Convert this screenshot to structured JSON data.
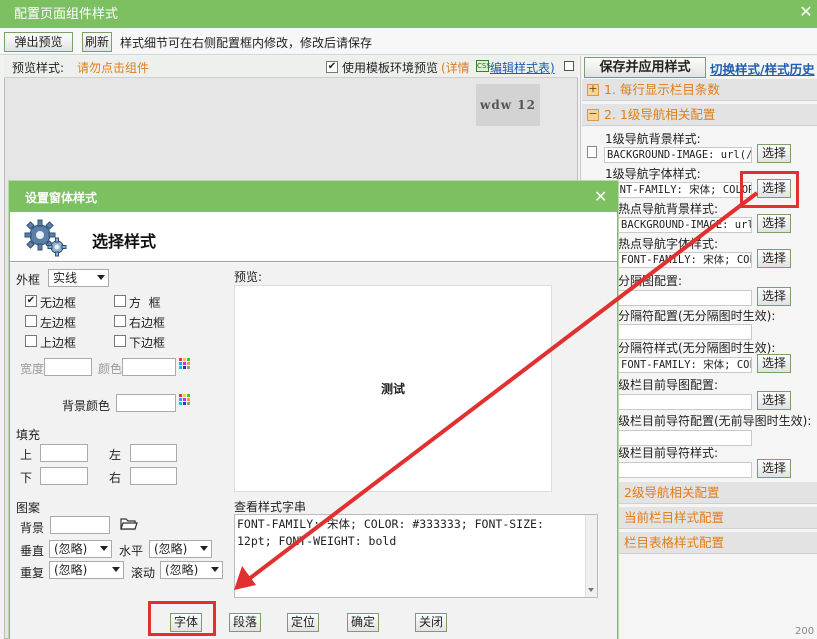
{
  "window": {
    "title": "配置页面组件样式",
    "close": "✕"
  },
  "toolbar": {
    "popup_preview": "弹出预览",
    "refresh": "刷新",
    "hint": "样式细节可在右侧配置框内修改，修改后请保存"
  },
  "preview": {
    "label": "预览样式:",
    "hint": "请勿点击组件",
    "template_checked": true,
    "template_label": "使用模板环境预览",
    "detail_link": "(详情",
    "edit_link": "编辑样式表)",
    "sample_text": "wdw 12"
  },
  "right": {
    "save_button": "保存并应用样式",
    "switch_link": "切换样式/样式历史",
    "sections": [
      {
        "label": "1. 每行显示栏目条数",
        "icon": "+"
      },
      {
        "label": "2. 1级导航相关配置",
        "icon": "−"
      },
      {
        "label": "2级导航相关配置",
        "icon": "+"
      },
      {
        "label": "当前栏目样式配置",
        "icon": "+"
      },
      {
        "label": "栏目表格样式配置",
        "icon": "+"
      }
    ],
    "config_items": [
      {
        "label": "1级导航背景样式:",
        "value": "BACKGROUND-IMAGE: url(/s",
        "button": "选择"
      },
      {
        "label": "1级导航字体样式:",
        "value": "FONT-FAMILY: 宋体; COLOR",
        "button": "选择"
      },
      {
        "label": "热点导航背景样式:",
        "value": "BACKGROUND-IMAGE: url(/s",
        "button": "选择"
      },
      {
        "label": "热点导航字体样式:",
        "value": "FONT-FAMILY: 宋体; COLOR",
        "button": "选择"
      },
      {
        "label": "分隔图配置:",
        "value": "",
        "button": "选择"
      },
      {
        "label": "分隔符配置(无分隔图时生效):",
        "value": "",
        "button": ""
      },
      {
        "label": "分隔符样式(无分隔图时生效):",
        "value": "FONT-FAMILY: 宋体; COLOR",
        "button": "选择"
      },
      {
        "label": "级栏目前导图配置:",
        "value": "",
        "button": "选择"
      },
      {
        "label": "级栏目前导符配置(无前导图时生效):",
        "value": "",
        "button": ""
      },
      {
        "label": "级栏目前导符样式:",
        "value": "",
        "button": "选择"
      }
    ],
    "corner_text": "200"
  },
  "dialog": {
    "title": "设置窗体样式",
    "close": "✕",
    "heading": "选择样式",
    "border": {
      "label": "外框",
      "style_value": "实线",
      "options": [
        {
          "label": "无边框",
          "checked": true
        },
        {
          "label": "方  框",
          "checked": false
        },
        {
          "label": "左边框",
          "checked": false
        },
        {
          "label": "右边框",
          "checked": false
        },
        {
          "label": "上边框",
          "checked": false
        },
        {
          "label": "下边框",
          "checked": false
        }
      ],
      "width_label": "宽度",
      "color_label": "颜色"
    },
    "bg_color_label": "背景颜色",
    "padding": {
      "label": "填充",
      "top": "上",
      "left": "左",
      "bottom": "下",
      "right": "右"
    },
    "pattern": {
      "label": "图案",
      "bg_label": "背景",
      "vertical_label": "垂直",
      "vertical_value": "(忽略)",
      "horizontal_label": "水平",
      "horizontal_value": "(忽略)",
      "repeat_label": "重复",
      "repeat_value": "(忽略)",
      "scroll_label": "滚动",
      "scroll_value": "(忽略)"
    },
    "preview_label": "预览:",
    "preview_text": "测试",
    "style_string_label": "查看样式字串",
    "style_string": "FONT-FAMILY: 宋体; COLOR: #333333; FONT-SIZE: 12pt; FONT-WEIGHT: bold",
    "buttons": {
      "font": "字体",
      "paragraph": "段落",
      "position": "定位",
      "ok": "确定",
      "close": "关闭"
    }
  },
  "colors": {
    "accent": "#7cc062",
    "orange": "#e07d1a",
    "link": "#1d5fb0",
    "highlight": "#e03030"
  }
}
